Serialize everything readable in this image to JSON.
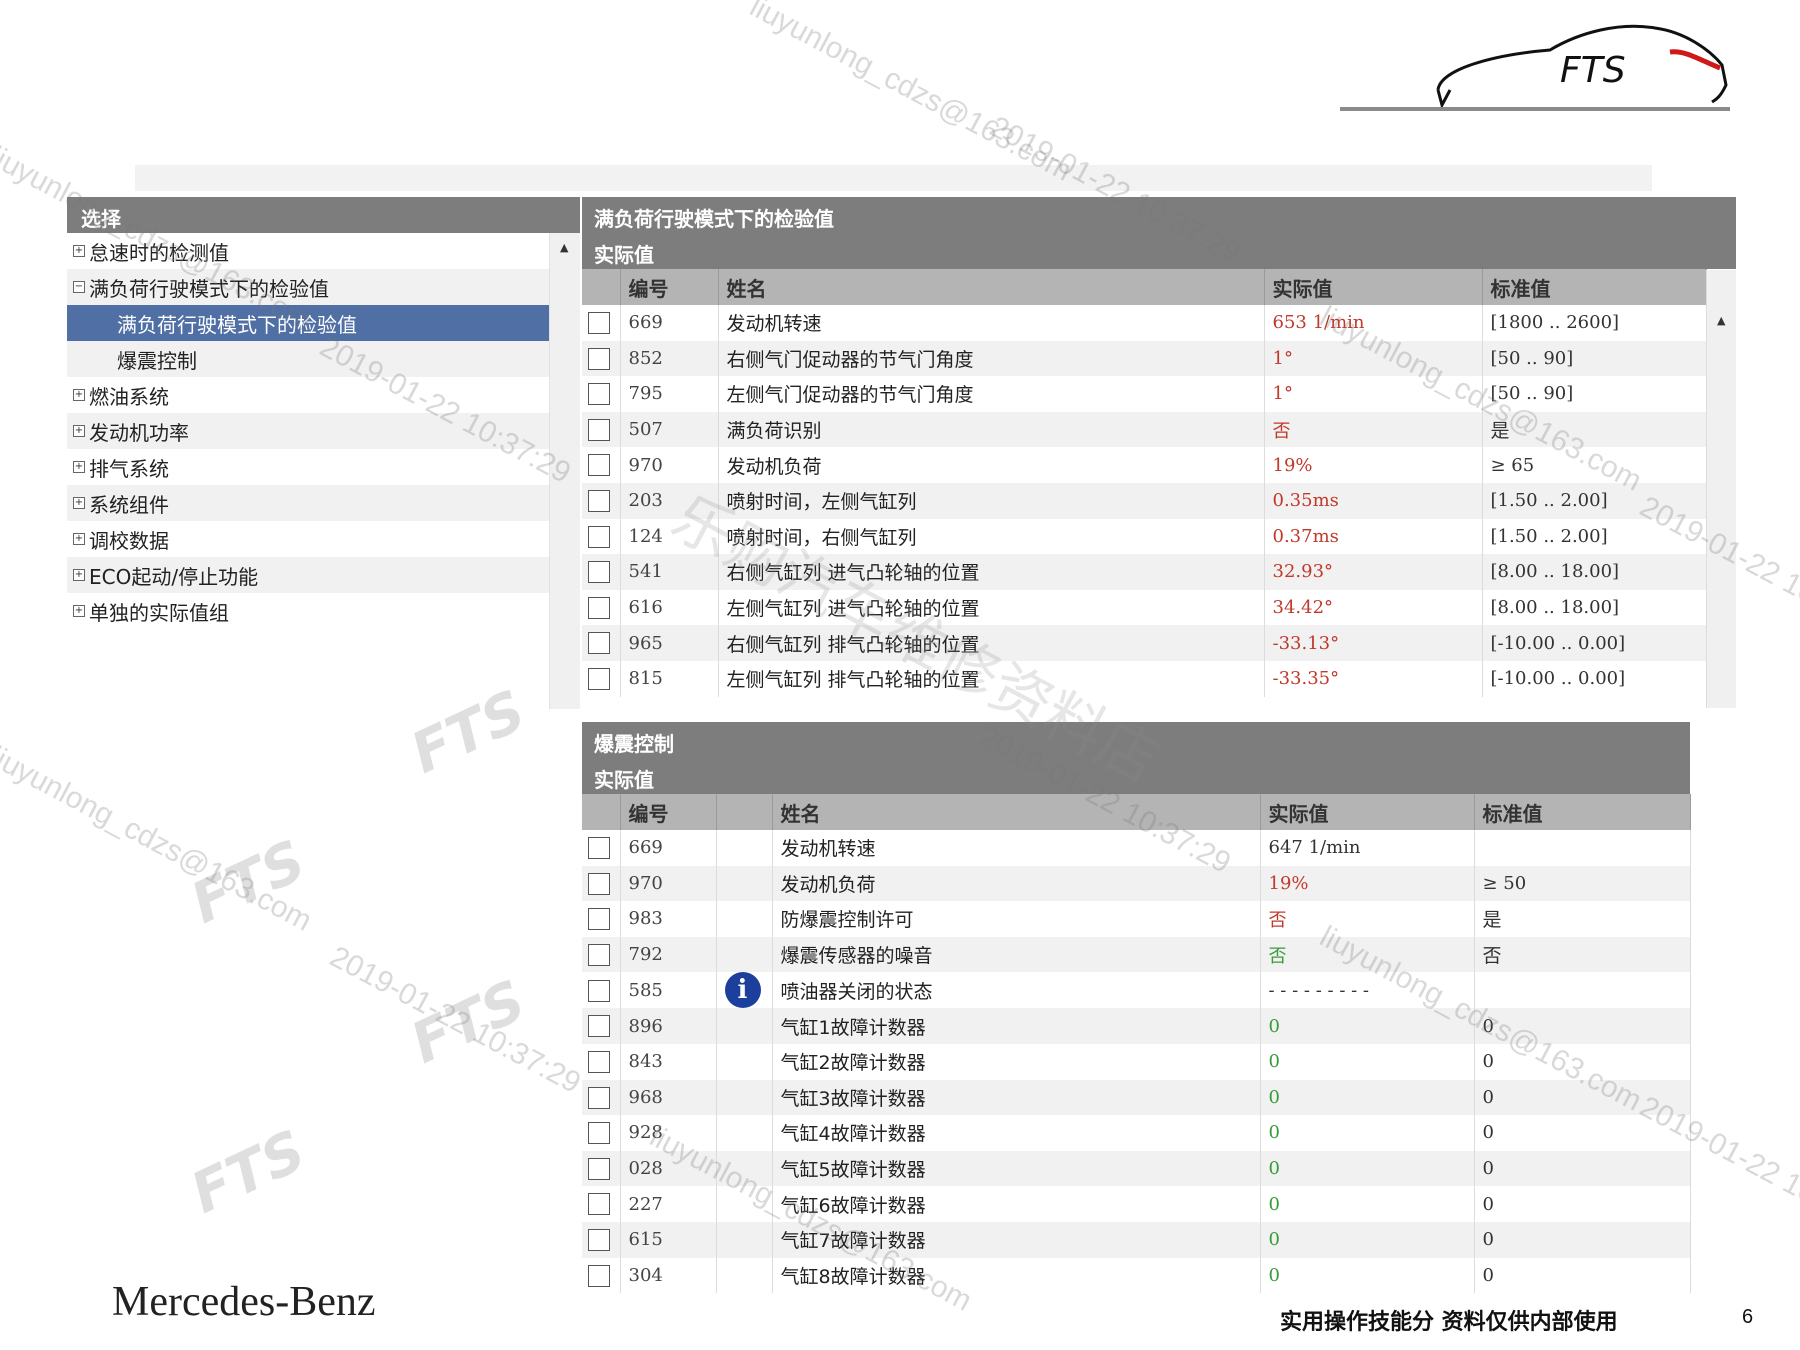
{
  "logo": {
    "text": "FTS"
  },
  "tree": {
    "header": "选择",
    "items": [
      {
        "label": "怠速时的检测值",
        "expander": "+"
      },
      {
        "label": "满负荷行驶模式下的检验值",
        "expander": "−"
      },
      {
        "label": "满负荷行驶模式下的检验值",
        "child": true,
        "selected": true
      },
      {
        "label": "爆震控制",
        "child": true
      },
      {
        "label": "燃油系统",
        "expander": "+"
      },
      {
        "label": "发动机功率",
        "expander": "+"
      },
      {
        "label": "排气系统",
        "expander": "+"
      },
      {
        "label": "系统组件",
        "expander": "+"
      },
      {
        "label": "调校数据",
        "expander": "+"
      },
      {
        "label": "ECO起动/停止功能",
        "expander": "+"
      },
      {
        "label": "单独的实际值组",
        "expander": "+"
      }
    ]
  },
  "table1": {
    "title": "满负荷行驶模式下的检验值",
    "subtitle": "实际值",
    "columns": [
      "编号",
      "姓名",
      "实际值",
      "标准值"
    ],
    "rows": [
      {
        "num": "669",
        "name": "发动机转速",
        "actual": "653 1/min",
        "std": "[1800 .. 2600]"
      },
      {
        "num": "852",
        "name": "右侧气门促动器的节气门角度",
        "actual": "1°",
        "std": "[50 .. 90]"
      },
      {
        "num": "795",
        "name": "左侧气门促动器的节气门角度",
        "actual": "1°",
        "std": "[50 .. 90]"
      },
      {
        "num": "507",
        "name": "满负荷识别",
        "actual": "否",
        "std": "是"
      },
      {
        "num": "970",
        "name": "发动机负荷",
        "actual": "19%",
        "std": "≥ 65"
      },
      {
        "num": "203",
        "name": "喷射时间，左侧气缸列",
        "actual": "0.35ms",
        "std": "[1.50 .. 2.00]"
      },
      {
        "num": "124",
        "name": "喷射时间，右侧气缸列",
        "actual": "0.37ms",
        "std": "[1.50 .. 2.00]"
      },
      {
        "num": "541",
        "name": "右侧气缸列 进气凸轮轴的位置",
        "actual": "32.93°",
        "std": "[8.00 .. 18.00]"
      },
      {
        "num": "616",
        "name": "左侧气缸列 进气凸轮轴的位置",
        "actual": "34.42°",
        "std": "[8.00 .. 18.00]"
      },
      {
        "num": "965",
        "name": "右侧气缸列 排气凸轮轴的位置",
        "actual": "-33.13°",
        "std": "[-10.00 .. 0.00]"
      },
      {
        "num": "815",
        "name": "左侧气缸列 排气凸轮轴的位置",
        "actual": "-33.35°",
        "std": "[-10.00 .. 0.00]"
      }
    ]
  },
  "table2": {
    "title": "爆震控制",
    "subtitle": "实际值",
    "columns": [
      "编号",
      "姓名",
      "实际值",
      "标准值"
    ],
    "rows": [
      {
        "num": "669",
        "name": "发动机转速",
        "actual": "647 1/min",
        "std": "",
        "tone": "normal"
      },
      {
        "num": "970",
        "name": "发动机负荷",
        "actual": "19%",
        "std": "≥ 50",
        "tone": "red"
      },
      {
        "num": "983",
        "name": "防爆震控制许可",
        "actual": "否",
        "std": "是",
        "tone": "red"
      },
      {
        "num": "792",
        "name": "爆震传感器的噪音",
        "actual": "否",
        "std": "否",
        "tone": "green"
      },
      {
        "num": "585",
        "name": "喷油器关闭的状态",
        "actual": "- - - - - - - - -",
        "std": "",
        "tone": "normal",
        "info": true
      },
      {
        "num": "896",
        "name": "气缸1故障计数器",
        "actual": "0",
        "std": "0",
        "tone": "green"
      },
      {
        "num": "843",
        "name": "气缸2故障计数器",
        "actual": "0",
        "std": "0",
        "tone": "green"
      },
      {
        "num": "968",
        "name": "气缸3故障计数器",
        "actual": "0",
        "std": "0",
        "tone": "green"
      },
      {
        "num": "928",
        "name": "气缸4故障计数器",
        "actual": "0",
        "std": "0",
        "tone": "green"
      },
      {
        "num": "028",
        "name": "气缸5故障计数器",
        "actual": "0",
        "std": "0",
        "tone": "green"
      },
      {
        "num": "227",
        "name": "气缸6故障计数器",
        "actual": "0",
        "std": "0",
        "tone": "green"
      },
      {
        "num": "615",
        "name": "气缸7故障计数器",
        "actual": "0",
        "std": "0",
        "tone": "green"
      },
      {
        "num": "304",
        "name": "气缸8故障计数器",
        "actual": "0",
        "std": "0",
        "tone": "green"
      }
    ]
  },
  "info_icon_glyph": "i",
  "footer": {
    "brand": "Mercedes-Benz",
    "note": "实用操作技能分 资料仅供内部使用",
    "page": "6"
  },
  "watermarks": {
    "email": "liuyunlong_cdzs@163.com",
    "timestamp": "2019-01-22 10:37:29",
    "fts": "FTS",
    "shop": "乐购汽车维修资料店"
  },
  "colors": {
    "header_gray": "#7d7d7d",
    "column_header": "#b4b4b4",
    "selected": "#4f6fa5",
    "bad_value": "#c0392b",
    "good_value": "#3a9b3a",
    "info_icon": "#1c3f9e"
  }
}
